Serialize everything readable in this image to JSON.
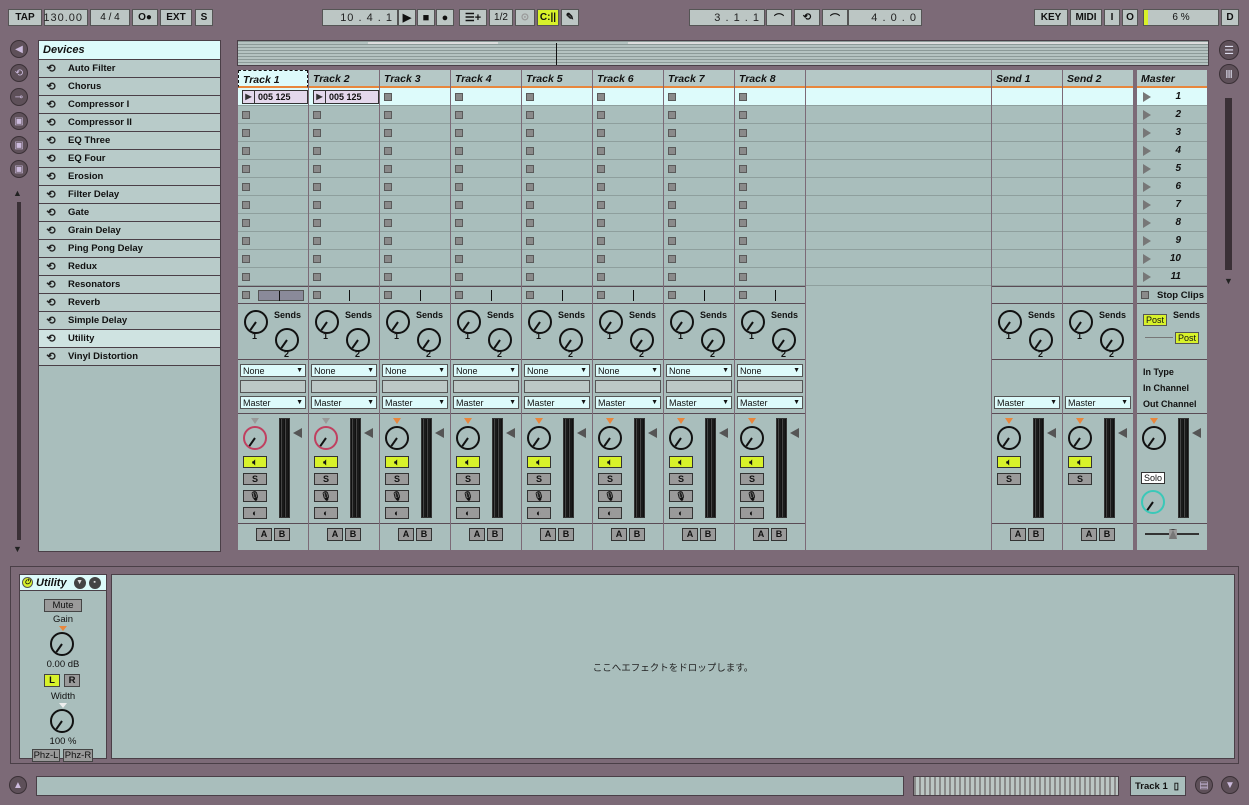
{
  "transport": {
    "tap": "TAP",
    "tempo": "130.00",
    "signature": "4 / 4",
    "metro": "O●",
    "ext": "EXT",
    "s": "S",
    "position": "10 .  4 .  1",
    "quantize": "1/2",
    "follow": "C:||",
    "loop_start": "3 .  1 .  1",
    "loop_length": "4 .  0 .  0",
    "key": "KEY",
    "midi": "MIDI",
    "i": "I",
    "o": "O",
    "cpu": "6 %",
    "d": "D"
  },
  "browser": {
    "title": "Devices",
    "items": [
      "Auto Filter",
      "Chorus",
      "Compressor I",
      "Compressor II",
      "EQ Three",
      "EQ Four",
      "Erosion",
      "Filter Delay",
      "Gate",
      "Grain Delay",
      "Ping Pong Delay",
      "Redux",
      "Resonators",
      "Reverb",
      "Simple Delay",
      "Utility",
      "Vinyl Distortion"
    ],
    "selected": "Utility"
  },
  "tracks": [
    {
      "name": "Track 1",
      "clip": "005 125",
      "pan_red": true
    },
    {
      "name": "Track 2",
      "clip": "005 125",
      "pan_red": true
    },
    {
      "name": "Track 3"
    },
    {
      "name": "Track 4"
    },
    {
      "name": "Track 5"
    },
    {
      "name": "Track 6"
    },
    {
      "name": "Track 7"
    },
    {
      "name": "Track 8"
    }
  ],
  "returns": [
    {
      "name": "Send 1"
    },
    {
      "name": "Send 2"
    }
  ],
  "master": {
    "name": "Master",
    "scenes": [
      "1",
      "2",
      "3",
      "4",
      "5",
      "6",
      "7",
      "8",
      "9",
      "10",
      "11"
    ],
    "stop_clips": "Stop Clips",
    "post1": "Post",
    "post2": "Post",
    "in_type": "In Type",
    "in_channel": "In Channel",
    "out_channel": "Out Channel",
    "solo": "Solo"
  },
  "labels": {
    "sends": "Sends",
    "knob1": "1",
    "knob2": "2",
    "input_none": "None",
    "output_master": "Master",
    "solo_s": "S",
    "a": "A",
    "b": "B"
  },
  "utility": {
    "title": "Utility",
    "mute": "Mute",
    "gain_label": "Gain",
    "gain_value": "0.00 dB",
    "l": "L",
    "r": "R",
    "width_label": "Width",
    "width_value": "100 %",
    "phz_l": "Phz-L",
    "phz_r": "Phz-R"
  },
  "dropzone_text": "ここへエフェクトをドロップします。",
  "status": {
    "track_name": "Track 1"
  },
  "colors": {
    "accent_green": "#d8f22a",
    "panel": "#a9bebc",
    "selected_slot": "#ddfbfb",
    "header_underline": "#e8863c"
  }
}
